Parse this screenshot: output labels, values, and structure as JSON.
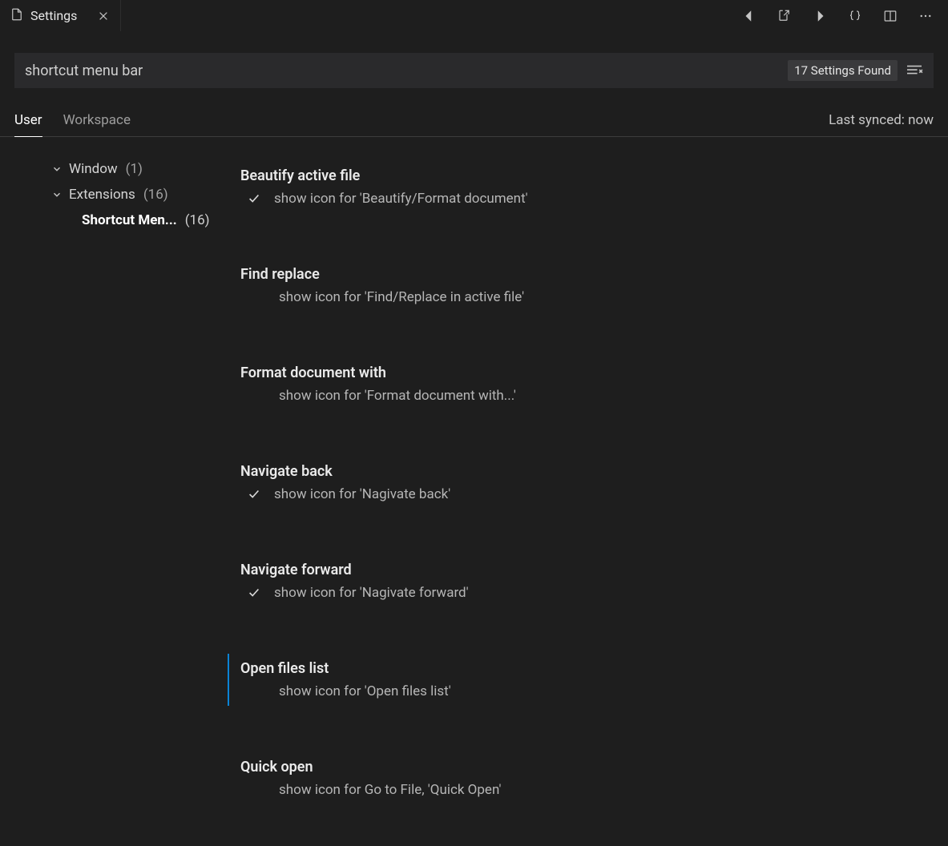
{
  "tab": {
    "title": "Settings"
  },
  "search": {
    "value": "shortcut menu bar",
    "results_label": "17 Settings Found"
  },
  "scope": {
    "tabs": [
      "User",
      "Workspace"
    ],
    "active": 0,
    "sync_status": "Last synced: now"
  },
  "tree": {
    "items": [
      {
        "label": "Window",
        "count": "(1)",
        "indent": 1,
        "expandable": true,
        "active": false
      },
      {
        "label": "Extensions",
        "count": "(16)",
        "indent": 1,
        "expandable": true,
        "active": false
      },
      {
        "label": "Shortcut Men...",
        "count": "(16)",
        "indent": 2,
        "expandable": false,
        "active": true
      }
    ]
  },
  "settings": [
    {
      "title": "Beautify active file",
      "desc": "show icon for 'Beautify/Format document'",
      "checked": true,
      "bar": false
    },
    {
      "title": "Find replace",
      "desc": "show icon for 'Find/Replace in active file'",
      "checked": false,
      "bar": false
    },
    {
      "title": "Format document with",
      "desc": "show icon for 'Format document with...'",
      "checked": false,
      "bar": false
    },
    {
      "title": "Navigate back",
      "desc": "show icon for 'Nagivate back'",
      "checked": true,
      "bar": false
    },
    {
      "title": "Navigate forward",
      "desc": "show icon for 'Nagivate forward'",
      "checked": true,
      "bar": false
    },
    {
      "title": "Open files list",
      "desc": "show icon for 'Open files list'",
      "checked": false,
      "bar": true
    },
    {
      "title": "Quick open",
      "desc": "show icon for Go to File, 'Quick Open'",
      "checked": false,
      "bar": false
    }
  ]
}
